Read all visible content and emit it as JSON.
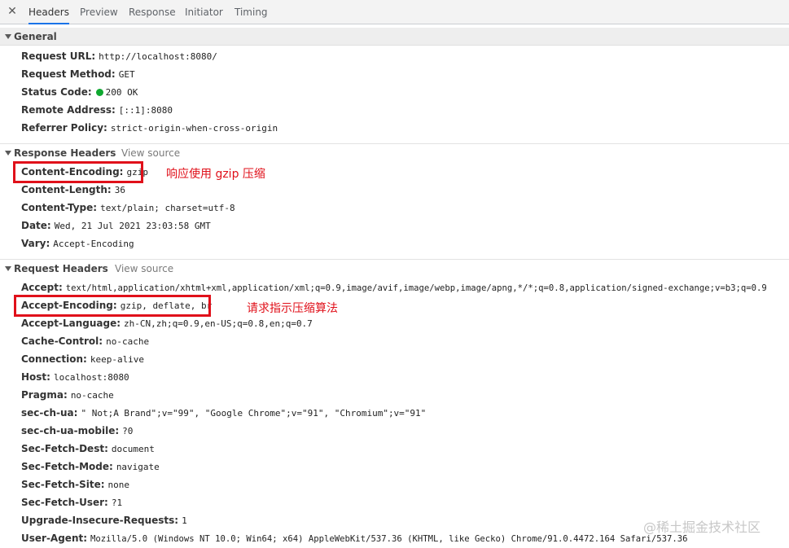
{
  "tabs": [
    {
      "label": "Headers",
      "active": true
    },
    {
      "label": "Preview"
    },
    {
      "label": "Response"
    },
    {
      "label": "Initiator"
    },
    {
      "label": "Timing"
    }
  ],
  "icons": {
    "close": "close-icon",
    "status": "green-status-dot"
  },
  "general": {
    "title": "General",
    "rows": [
      {
        "key": "Request URL:",
        "value": "http://localhost:8080/"
      },
      {
        "key": "Request Method:",
        "value": "GET"
      },
      {
        "key": "Status Code:",
        "value": "200 OK"
      },
      {
        "key": "Remote Address:",
        "value": "[::1]:8080"
      },
      {
        "key": "Referrer Policy:",
        "value": "strict-origin-when-cross-origin"
      }
    ]
  },
  "response_headers": {
    "title": "Response Headers",
    "view_source": "View source",
    "rows": [
      {
        "key": "Content-Encoding:",
        "value": "gzip"
      },
      {
        "key": "Content-Length:",
        "value": "36"
      },
      {
        "key": "Content-Type:",
        "value": "text/plain; charset=utf-8"
      },
      {
        "key": "Date:",
        "value": "Wed, 21 Jul 2021 23:03:58 GMT"
      },
      {
        "key": "Vary:",
        "value": "Accept-Encoding"
      }
    ]
  },
  "request_headers": {
    "title": "Request Headers",
    "view_source": "View source",
    "rows": [
      {
        "key": "Accept:",
        "value": "text/html,application/xhtml+xml,application/xml;q=0.9,image/avif,image/webp,image/apng,*/*;q=0.8,application/signed-exchange;v=b3;q=0.9"
      },
      {
        "key": "Accept-Encoding:",
        "value": "gzip, deflate, br"
      },
      {
        "key": "Accept-Language:",
        "value": "zh-CN,zh;q=0.9,en-US;q=0.8,en;q=0.7"
      },
      {
        "key": "Cache-Control:",
        "value": "no-cache"
      },
      {
        "key": "Connection:",
        "value": "keep-alive"
      },
      {
        "key": "Host:",
        "value": "localhost:8080"
      },
      {
        "key": "Pragma:",
        "value": "no-cache"
      },
      {
        "key": "sec-ch-ua:",
        "value": "\" Not;A Brand\";v=\"99\", \"Google Chrome\";v=\"91\", \"Chromium\";v=\"91\""
      },
      {
        "key": "sec-ch-ua-mobile:",
        "value": "?0"
      },
      {
        "key": "Sec-Fetch-Dest:",
        "value": "document"
      },
      {
        "key": "Sec-Fetch-Mode:",
        "value": "navigate"
      },
      {
        "key": "Sec-Fetch-Site:",
        "value": "none"
      },
      {
        "key": "Sec-Fetch-User:",
        "value": "?1"
      },
      {
        "key": "Upgrade-Insecure-Requests:",
        "value": "1"
      },
      {
        "key": "User-Agent:",
        "value": "Mozilla/5.0 (Windows NT 10.0; Win64; x64) AppleWebKit/537.36 (KHTML, like Gecko) Chrome/91.0.4472.164 Safari/537.36"
      }
    ]
  },
  "annotations": {
    "response": "响应使用 gzip 压缩",
    "request": "请求指示压缩算法"
  },
  "watermark": "@稀土掘金技术社区",
  "colors": {
    "highlight": "#e0101a",
    "status_ok": "#0fa830",
    "active_tab": "#1a73e8"
  }
}
